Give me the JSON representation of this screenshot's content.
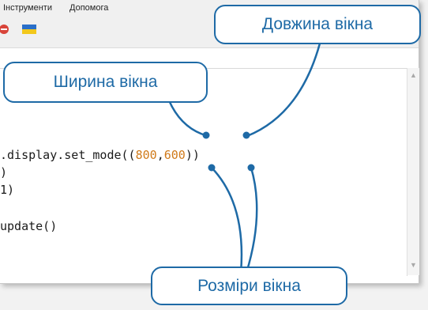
{
  "menu": {
    "items": [
      "Інструменти",
      "Допомога"
    ]
  },
  "toolbar": {
    "icons": [
      "stop-icon",
      "flag-icon"
    ]
  },
  "code": {
    "line1": [
      ".display.set_mode((",
      "800",
      ",",
      "600",
      "))"
    ],
    "line2": ")",
    "line3": "1)",
    "line4": "update()"
  },
  "callouts": {
    "length": "Довжина вікна",
    "width": "Ширина вікна",
    "sizes": "Розміри вікна"
  },
  "colors": {
    "accent": "#1e6aa6",
    "number": "#d07a1a"
  }
}
